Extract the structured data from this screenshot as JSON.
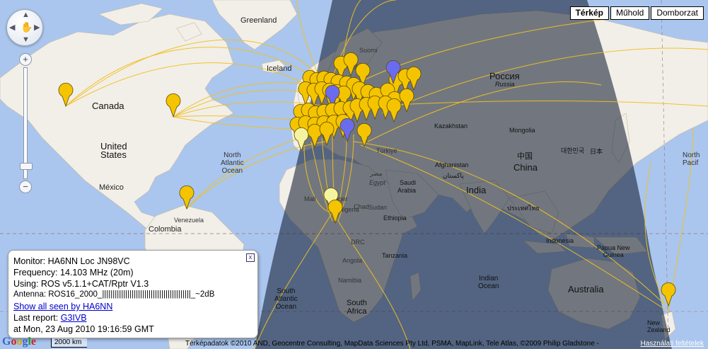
{
  "map_type_buttons": [
    {
      "label": "Térkép",
      "active": true
    },
    {
      "label": "Műhold",
      "active": false
    },
    {
      "label": "Domborzat",
      "active": false
    }
  ],
  "labels": {
    "greenland": "Greenland",
    "iceland": "Iceland",
    "canada": "Canada",
    "united_states_1": "United",
    "united_states_2": "States",
    "mexico": "México",
    "north_atlantic_1": "North",
    "north_atlantic_2": "Atlantic",
    "north_atlantic_3": "Ocean",
    "venezuela": "Venezuela",
    "colombia": "Colombia",
    "suomi": "Suomi",
    "sverige": "Sverige",
    "russia_native": "Россия",
    "russia": "Russia",
    "kazakhstan": "Kazakhstan",
    "mongolia": "Mongolia",
    "china_native": "中国",
    "china": "China",
    "korea": "대한민국",
    "japan": "日本",
    "turkiye": "Türkiye",
    "afghanistan": "Afghanistan",
    "pakistan": "پاکستان",
    "egypt_native": "مصر",
    "egypt": "Egypt",
    "saudi_1": "Saudi",
    "saudi_2": "Arabia",
    "india": "India",
    "thailand": "ประเทศไทย",
    "mali": "Mali",
    "niger": "Niger",
    "chad": "Chad",
    "sudan": "Sudan",
    "nigeria": "Nigeria",
    "ethiopia": "Ethiopia",
    "drc": "DRC",
    "tanzania": "Tanzania",
    "angola": "Angola",
    "namibia": "Namibia",
    "south_africa_1": "South",
    "south_africa_2": "Africa",
    "south_atlantic_1": "South",
    "south_atlantic_2": "Atlantic",
    "south_atlantic_3": "Ocean",
    "indian_ocean_1": "Indian",
    "indian_ocean_2": "Ocean",
    "papua_1": "Papua New",
    "papua_2": "Guinea",
    "indonesia": "Indonesia",
    "australia": "Australia",
    "new_zealand_1": "New",
    "new_zealand_2": "Zealand",
    "north_pacific_1": "North",
    "north_pacific_2": "Pacif"
  },
  "info": {
    "monitor": "Monitor: HA6NN Loc JN98VC",
    "frequency": "Frequency: 14.103 MHz (20m)",
    "using": "Using: ROS v5.1.1+CAT/Rptr V1.3",
    "antenna": "Antenna: ROS16_2000_||||||||||||||||||||||||||||||||||||||||||_~2dB",
    "show_all": "Show all seen by HA6NN",
    "last_report_label": "Last report:",
    "last_report_call": "G3IVB",
    "timestamp": "at Mon, 23 Aug 2010 19:16:59 GMT",
    "close_glyph": "x"
  },
  "footer": {
    "logo": [
      "G",
      "o",
      "o",
      "g",
      "l",
      "e"
    ],
    "scale": "2000 km",
    "copyright": "Térképadatok ©2010 AND, Geocentre Consulting, MapData Sciences Pty Ltd, PSMA, MapLink, Tele Atlas, ©2009 Philip Gladstone -",
    "terms": "Használati feltételek"
  },
  "colors": {
    "ocean": "#aac6ee",
    "land": "#f2efe9",
    "night_shade": "rgba(10,20,40,0.55)",
    "path": "#f0c020",
    "pin_yellow": "#f5c400",
    "pin_pale": "#f4f4a0",
    "pin_blue": "#6b6bf0"
  }
}
